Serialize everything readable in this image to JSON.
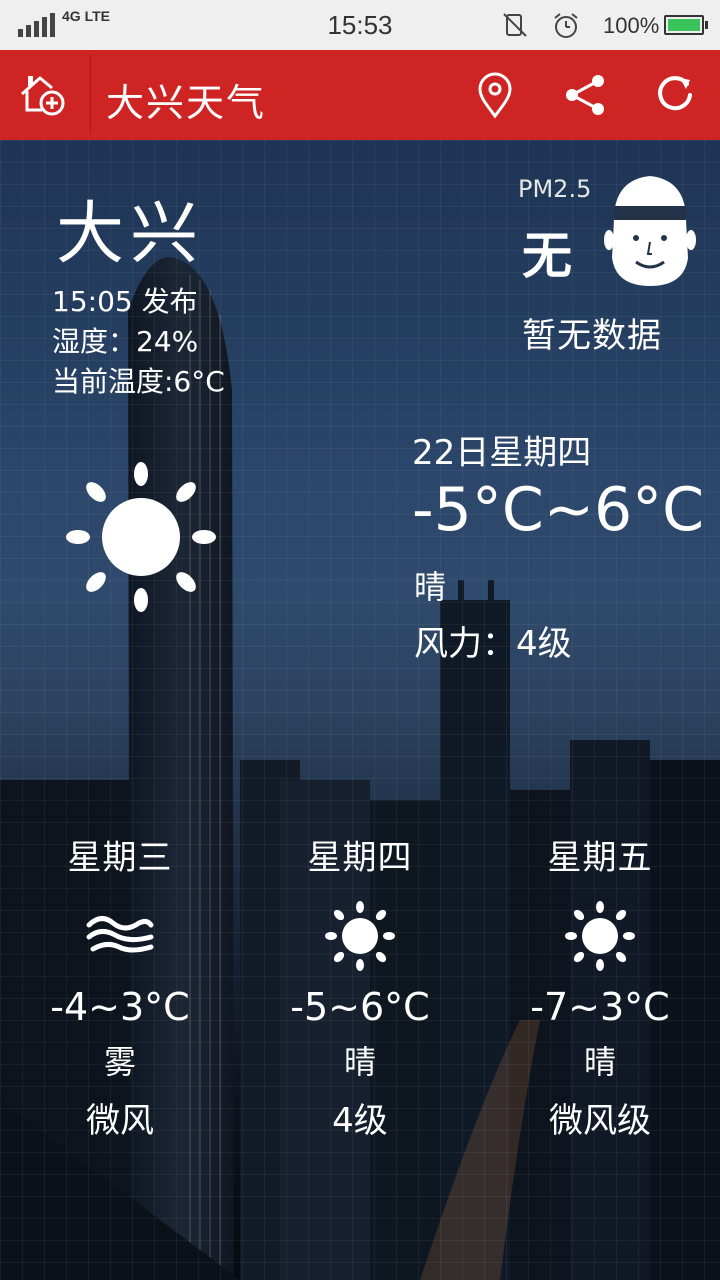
{
  "status_bar": {
    "network": "4G LTE",
    "time": "15:53",
    "battery": "100%",
    "icons": [
      "signal-icon",
      "mute-icon",
      "alarm-icon",
      "battery-icon"
    ]
  },
  "app_bar": {
    "title": "大兴天气",
    "icons": [
      "home-add-icon",
      "location-pin-icon",
      "share-icon",
      "refresh-icon"
    ],
    "color": "#cf2424"
  },
  "current": {
    "city": "大兴",
    "publish_time": "15:05 发布",
    "humidity": "湿度：24%",
    "current_temp": "当前温度:6°C",
    "icon": "sun-icon"
  },
  "pm25": {
    "label": "PM2.5",
    "value": "无",
    "description": "暂无数据",
    "icon": "face-icon"
  },
  "today": {
    "date": "22日星期四",
    "range": "-5°C~6°C",
    "condition": "晴",
    "wind": "风力：4级"
  },
  "forecast": [
    {
      "day": "星期三",
      "icon": "fog-icon",
      "range": "-4~3°C",
      "condition": "雾",
      "wind": "微风"
    },
    {
      "day": "星期四",
      "icon": "sun-icon",
      "range": "-5~6°C",
      "condition": "晴",
      "wind": "4级"
    },
    {
      "day": "星期五",
      "icon": "sun-icon",
      "range": "-7~3°C",
      "condition": "晴",
      "wind": "微风级"
    }
  ]
}
